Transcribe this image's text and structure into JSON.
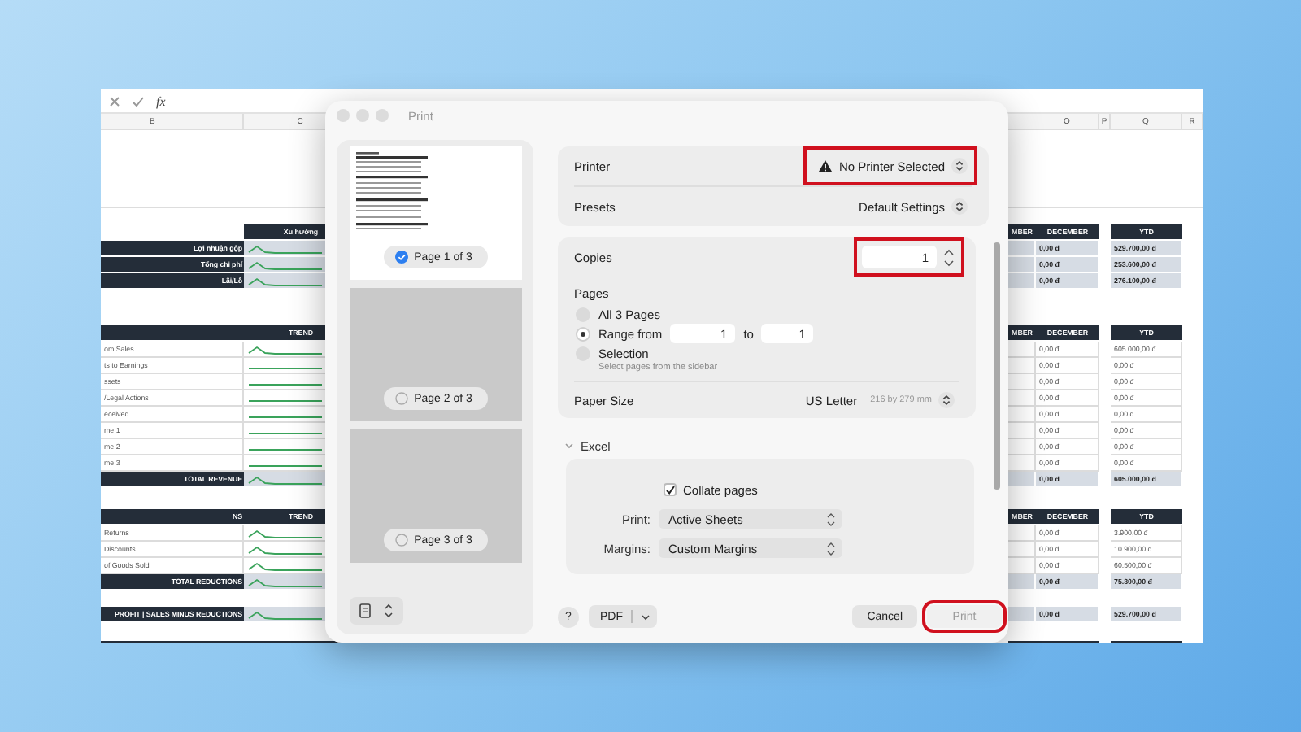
{
  "sheet": {
    "formula_label": "fx",
    "columns_left": [
      "B",
      "C"
    ],
    "columns_right": [
      "O",
      "P",
      "Q",
      "R"
    ],
    "sections": [
      {
        "rows": [
          {
            "kind": "header-corner",
            "c": "Xu hướng",
            "n": "MBER",
            "o": "DECEMBER",
            "q": "YTD"
          },
          {
            "kind": "label",
            "b": "Lợi nhuận gộp",
            "sparkline": {
              "kind": "wave"
            },
            "o": "0,00 đ",
            "q": "529.700,00 đ"
          },
          {
            "kind": "label",
            "b": "Tổng chi phí",
            "sparkline": {
              "kind": "wave"
            },
            "o": "0,00 đ",
            "q": "253.600,00 đ"
          },
          {
            "kind": "label",
            "b": "Lãi/Lỗ",
            "sparkline": {
              "kind": "wave"
            },
            "o": "0,00 đ",
            "q": "276.100,00 đ"
          }
        ]
      },
      {
        "rows": [
          {
            "kind": "header",
            "c": "TREND",
            "n": "MBER",
            "o": "DECEMBER",
            "q": "YTD"
          },
          {
            "kind": "item",
            "b": "om Sales",
            "sparkline": {
              "kind": "wave"
            },
            "o": "0,00 đ",
            "q": "605.000,00 đ"
          },
          {
            "kind": "item",
            "b": "ts to Earnings",
            "sparkline": {
              "kind": "flat"
            },
            "o": "0,00 đ",
            "q": "0,00 đ"
          },
          {
            "kind": "item",
            "b": "ssets",
            "sparkline": {
              "kind": "flat"
            },
            "o": "0,00 đ",
            "q": "0,00 đ"
          },
          {
            "kind": "item",
            "b": "/Legal Actions",
            "sparkline": {
              "kind": "flat"
            },
            "o": "0,00 đ",
            "q": "0,00 đ"
          },
          {
            "kind": "item",
            "b": "eceived",
            "sparkline": {
              "kind": "flat"
            },
            "o": "0,00 đ",
            "q": "0,00 đ"
          },
          {
            "kind": "item",
            "b": "me 1",
            "sparkline": {
              "kind": "flat"
            },
            "o": "0,00 đ",
            "q": "0,00 đ"
          },
          {
            "kind": "item",
            "b": "me 2",
            "sparkline": {
              "kind": "flat"
            },
            "o": "0,00 đ",
            "q": "0,00 đ"
          },
          {
            "kind": "item",
            "b": "me 3",
            "sparkline": {
              "kind": "flat"
            },
            "o": "0,00 đ",
            "q": "0,00 đ"
          },
          {
            "kind": "total",
            "b": "TOTAL REVENUE",
            "sparkline": {
              "kind": "wave"
            },
            "o": "0,00 đ",
            "q": "605.000,00 đ"
          }
        ]
      },
      {
        "rows": [
          {
            "kind": "header",
            "b": "NS",
            "c": "TREND",
            "n": "MBER",
            "o": "DECEMBER",
            "q": "YTD"
          },
          {
            "kind": "item",
            "b": "Returns",
            "sparkline": {
              "kind": "wave"
            },
            "o": "0,00 đ",
            "q": "3.900,00 đ"
          },
          {
            "kind": "item",
            "b": "Discounts",
            "sparkline": {
              "kind": "wave"
            },
            "o": "0,00 đ",
            "q": "10.900,00 đ"
          },
          {
            "kind": "item",
            "b": "of Goods Sold",
            "sparkline": {
              "kind": "wave"
            },
            "o": "0,00 đ",
            "q": "60.500,00 đ"
          },
          {
            "kind": "total",
            "b": "TOTAL REDUCTIONS",
            "sparkline": {
              "kind": "wave"
            },
            "o": "0,00 đ",
            "q": "75.300,00 đ"
          }
        ]
      },
      {
        "rows": [
          {
            "kind": "total",
            "b": "PROFIT | SALES MINUS REDUCTIONS",
            "sparkline": {
              "kind": "wave"
            },
            "o": "0,00 đ",
            "q": "529.700,00 đ"
          }
        ]
      },
      {
        "rows": [
          {
            "kind": "band"
          }
        ]
      }
    ]
  },
  "print_dialog": {
    "title": "Print",
    "pages": [
      {
        "label": "Page 1 of 3",
        "selected": true,
        "kind": "preview"
      },
      {
        "label": "Page 2 of 3",
        "selected": false,
        "kind": "blank"
      },
      {
        "label": "Page 3 of 3",
        "selected": false,
        "kind": "blank"
      }
    ],
    "printer": {
      "label": "Printer",
      "value": "No Printer Selected",
      "warning": true,
      "highlighted": true
    },
    "presets": {
      "label": "Presets",
      "value": "Default Settings"
    },
    "copies": {
      "label": "Copies",
      "value": "1",
      "highlighted": true
    },
    "pages_range": {
      "label": "Pages",
      "options": [
        {
          "label": "All 3 Pages",
          "selected": false
        },
        {
          "label": "Range from",
          "selected": true,
          "from": "1",
          "to_label": "to",
          "to": "1"
        },
        {
          "label": "Selection",
          "selected": false,
          "hint": "Select pages from the sidebar"
        }
      ]
    },
    "paper_size": {
      "label": "Paper Size",
      "value": "US Letter",
      "detail": "216 by 279 mm"
    },
    "section": {
      "title": "Excel",
      "expanded": true,
      "collate": {
        "label": "Collate pages",
        "checked": true
      },
      "fields": [
        {
          "label": "Print:",
          "value": "Active Sheets"
        },
        {
          "label": "Margins:",
          "value": "Custom Margins"
        }
      ]
    },
    "footer": {
      "help": "?",
      "pdf": "PDF",
      "cancel": "Cancel",
      "print": {
        "label": "Print",
        "disabled": true,
        "highlighted": true
      }
    }
  }
}
